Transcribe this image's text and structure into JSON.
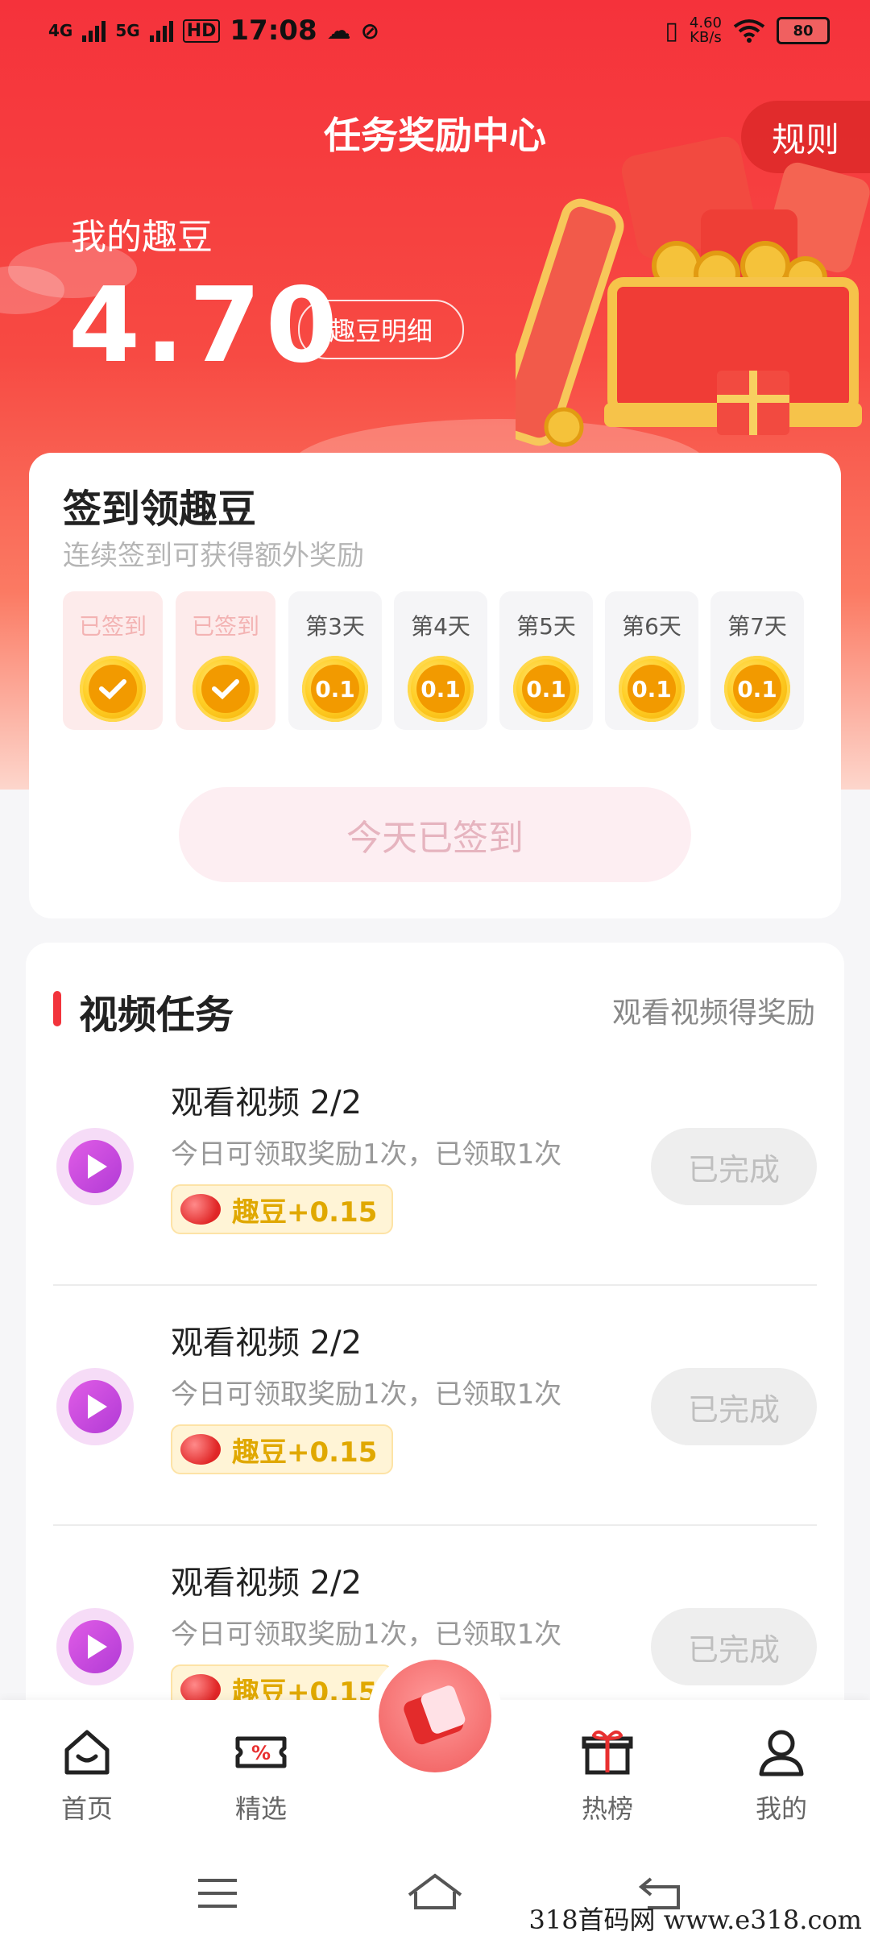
{
  "status_bar": {
    "network_1": "4G",
    "network_2": "5G",
    "hd": "HD",
    "time": "17:08",
    "speed": "4.60",
    "speed_unit": "KB/s",
    "battery": "80"
  },
  "header": {
    "title": "任务奖励中心",
    "rules_label": "规则",
    "my_beans_label": "我的趣豆",
    "balance": "4.70",
    "detail_label": "趣豆明细"
  },
  "signin": {
    "title": "签到领趣豆",
    "subtitle": "连续签到可获得额外奖励",
    "days": [
      {
        "label": "已签到",
        "done": true
      },
      {
        "label": "已签到",
        "done": true
      },
      {
        "label": "第3天",
        "reward": "0.1"
      },
      {
        "label": "第4天",
        "reward": "0.1"
      },
      {
        "label": "第5天",
        "reward": "0.1"
      },
      {
        "label": "第6天",
        "reward": "0.1"
      },
      {
        "label": "第7天",
        "reward": "0.1"
      }
    ],
    "button_label": "今天已签到"
  },
  "video_tasks": {
    "title": "视频任务",
    "hint": "观看视频得奖励",
    "items": [
      {
        "name": "观看视频 2/2",
        "desc": "今日可领取奖励1次，已领取1次",
        "reward": "趣豆+0.15",
        "status": "已完成"
      },
      {
        "name": "观看视频 2/2",
        "desc": "今日可领取奖励1次，已领取1次",
        "reward": "趣豆+0.15",
        "status": "已完成"
      },
      {
        "name": "观看视频 2/2",
        "desc": "今日可领取奖励1次，已领取1次",
        "reward": "趣豆+0.15",
        "status": "已完成"
      }
    ]
  },
  "tabbar": {
    "items": [
      {
        "label": "首页",
        "icon": "home-icon"
      },
      {
        "label": "精选",
        "icon": "coupon-icon"
      },
      {
        "label": "",
        "icon": "red-envelope-icon"
      },
      {
        "label": "热榜",
        "icon": "gift-icon"
      },
      {
        "label": "我的",
        "icon": "profile-icon"
      }
    ]
  },
  "watermark": "318首码网  www.e318.com",
  "colors": {
    "brand_red": "#f5323b",
    "coin_gold": "#ffcf26",
    "play_purple": "#c447dc"
  }
}
